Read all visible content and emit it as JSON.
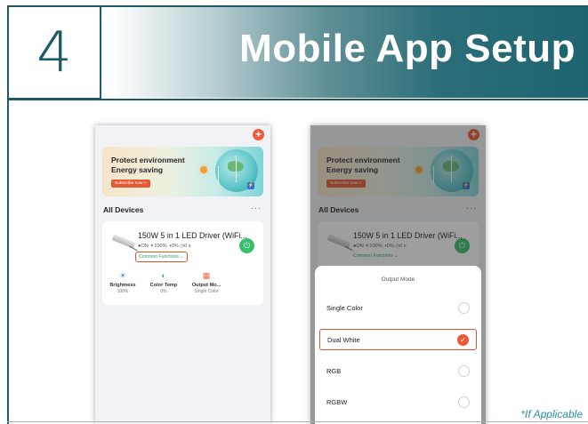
{
  "header": {
    "step_number": "4",
    "title": "Mobile App Setup"
  },
  "banner": {
    "line1": "Protect environment",
    "line2": "Energy saving",
    "button": "Subscribe now >"
  },
  "devices": {
    "title": "All Devices",
    "more": "···",
    "card": {
      "name": "150W 5 in 1 LED Driver (WiFi...",
      "status": "●ON  ☀100%  ◑0%  ◷0 s",
      "common_functions": "Common Functions ⌄",
      "controls": [
        {
          "label": "Brightness",
          "value": "100%"
        },
        {
          "label": "Color Temp",
          "value": "0%"
        },
        {
          "label": "Output Mo...",
          "value": "Single Color"
        }
      ]
    }
  },
  "output_mode_sheet": {
    "title": "Output Mode",
    "options": [
      {
        "label": "Single Color",
        "selected": false
      },
      {
        "label": "Dual White",
        "selected": true
      },
      {
        "label": "RGB",
        "selected": false
      },
      {
        "label": "RGBW",
        "selected": false
      }
    ]
  },
  "footnote": "*If Applicable",
  "colors": {
    "brand_teal": "#1d5a66",
    "accent_orange": "#e3522d",
    "power_green": "#38c06a"
  },
  "icons": {
    "plus": "+",
    "power": "⏻",
    "brightness": "☀",
    "color_temp": "◐",
    "output_mode": "▦",
    "check": "✓",
    "bolt": "⚡"
  }
}
